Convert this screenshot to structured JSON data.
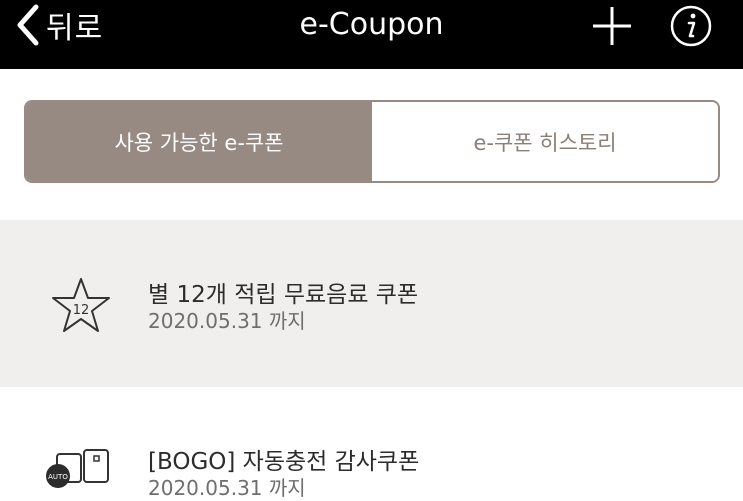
{
  "header": {
    "back_label": "뒤로",
    "title": "e-Coupon"
  },
  "tabs": [
    {
      "label": "사용 가능한 e-쿠폰",
      "active": true
    },
    {
      "label": "e-쿠폰 히스토리",
      "active": false
    }
  ],
  "coupons": [
    {
      "title": "별 12개 적립 무료음료 쿠폰",
      "expiry": "2020.05.31 까지",
      "icon": "star-12-icon",
      "icon_text": "12"
    },
    {
      "title": "[BOGO] 자동충전 감사쿠폰",
      "expiry": "2020.05.31 까지",
      "icon": "auto-card-icon",
      "icon_text": "AUTO"
    }
  ],
  "colors": {
    "header_bg": "#000000",
    "tab_active_bg": "#978a83",
    "tab_inactive_text": "#8a7f79",
    "highlight_row_bg": "#f0efee"
  }
}
